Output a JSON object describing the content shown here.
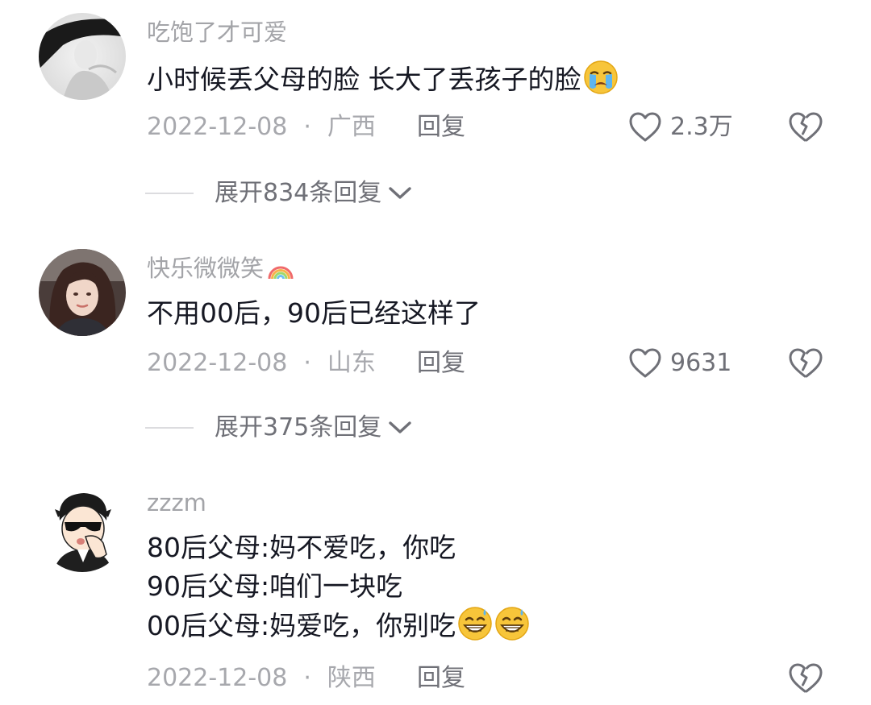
{
  "comments": [
    {
      "username": "吃饱了才可爱",
      "content_lines": [
        "小时候丢父母的脸 长大了丢孩子的脸"
      ],
      "content_emojis": [
        "crying-face-emoji"
      ],
      "date": "2022-12-08",
      "separator": "·",
      "location": "广西",
      "reply_label": "回复",
      "like_count": "2.3万",
      "expand_label": "展开834条回复"
    },
    {
      "username": "快乐微微笑",
      "username_emoji": "rainbow-emoji",
      "content_lines": [
        "不用00后，90后已经这样了"
      ],
      "date": "2022-12-08",
      "separator": "·",
      "location": "山东",
      "reply_label": "回复",
      "like_count": "9631",
      "expand_label": "展开375条回复"
    },
    {
      "username": "zzzm",
      "content_lines": [
        "80后父母:妈不爱吃，你吃",
        "90后父母:咱们一块吃",
        "00后父母:妈爱吃，你别吃"
      ],
      "content_emojis": [
        "grinning-sweat-emoji",
        "grinning-sweat-emoji"
      ],
      "date": "2022-12-08",
      "separator": "·",
      "location": "陕西",
      "reply_label": "回复"
    }
  ],
  "colors": {
    "text": "#161823",
    "muted": "#a7a8ad",
    "action": "#6f7077",
    "rule": "#dcdcdf"
  },
  "icons": {
    "like": "heart-outline-icon",
    "dislike": "broken-heart-icon",
    "expand": "chevron-down-icon"
  }
}
